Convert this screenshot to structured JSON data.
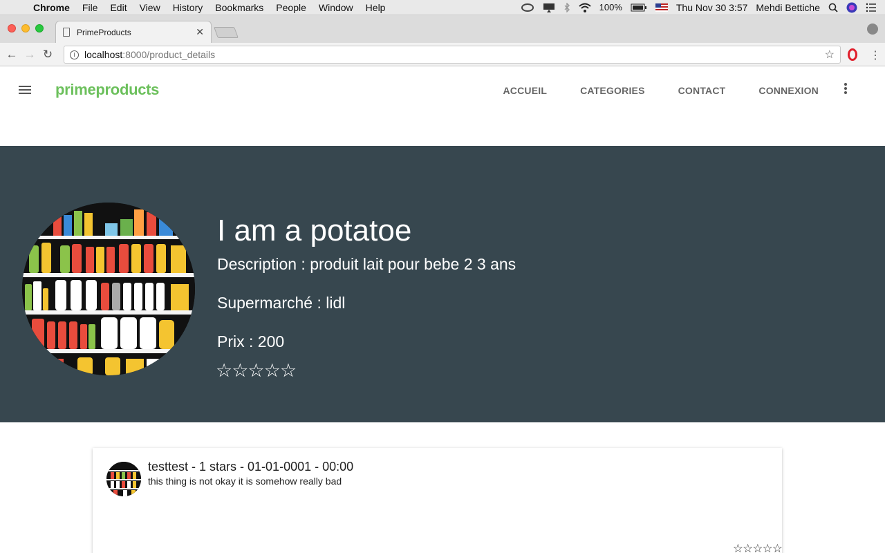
{
  "os_menubar": {
    "app": "Chrome",
    "menus": [
      "File",
      "Edit",
      "View",
      "History",
      "Bookmarks",
      "People",
      "Window",
      "Help"
    ],
    "battery": "100%",
    "clock": "Thu Nov 30  3:57",
    "user": "Mehdi Bettiche"
  },
  "browser": {
    "tab_title": "PrimeProducts",
    "url_host": "localhost",
    "url_path": ":8000/product_details"
  },
  "site": {
    "brand": "primeproducts",
    "nav": [
      "ACCUEIL",
      "CATEGORIES",
      "CONTACT",
      "CONNEXION"
    ]
  },
  "product": {
    "title": "I am a potatoe",
    "description": "Description : produit lait pour bebe 2 3 ans",
    "supermarket": "Supermarché : lidl",
    "price": "Prix : 200",
    "stars_display": "☆☆☆☆☆",
    "rating": 0
  },
  "review": {
    "header": "testtest - 1 stars - 01-01-0001 - 00:00",
    "body": "this thing is not okay it is somehow really bad",
    "stars_display": "☆☆☆☆☆"
  },
  "colors": {
    "brand": "#6cc05c",
    "hero_bg": "#37474f",
    "nav_link": "#666666"
  }
}
